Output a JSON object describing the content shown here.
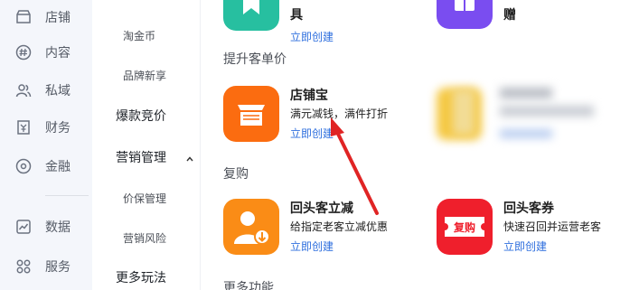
{
  "rail": {
    "items": [
      {
        "label": "店铺",
        "icon": "store-icon"
      },
      {
        "label": "内容",
        "icon": "hashtag-icon"
      },
      {
        "label": "私域",
        "icon": "users-icon"
      },
      {
        "label": "财务",
        "icon": "finance-icon"
      },
      {
        "label": "金融",
        "icon": "coin-icon"
      },
      {
        "label": "数据",
        "icon": "chart-icon"
      },
      {
        "label": "服务",
        "icon": "grid-icon"
      }
    ]
  },
  "menu": {
    "taojinbi": "淘金币",
    "brand_new": "品牌新享",
    "hot_bidding": "爆款竞价",
    "marketing_mgmt": "营销管理",
    "price_protect": "价保管理",
    "marketing_risk": "营销风险",
    "more_play": "更多玩法"
  },
  "content": {
    "top_left": {
      "name_tail": "具",
      "link": "立即创建"
    },
    "top_right": {
      "name_tail": "赠"
    },
    "section_upsell": "提升客单价",
    "dianpubao": {
      "name": "店铺宝",
      "desc": "满元减钱，满件打折",
      "link": "立即创建"
    },
    "section_repurchase": "复购",
    "huitou_lijian": {
      "name": "回头客立减",
      "desc": "给指定老客立减优惠",
      "link": "立即创建"
    },
    "huitou_quan": {
      "name": "回头客券",
      "desc": "快速召回并运营老客",
      "link": "立即创建",
      "badge": "复购"
    },
    "section_more": "更多功能"
  },
  "colors": {
    "accent_blue": "#2f6fde",
    "orange": "#fb6c10",
    "red": "#ef1f2c",
    "teal": "#27bfa0",
    "purple": "#7a4df0",
    "annotation_red": "#e02424"
  }
}
